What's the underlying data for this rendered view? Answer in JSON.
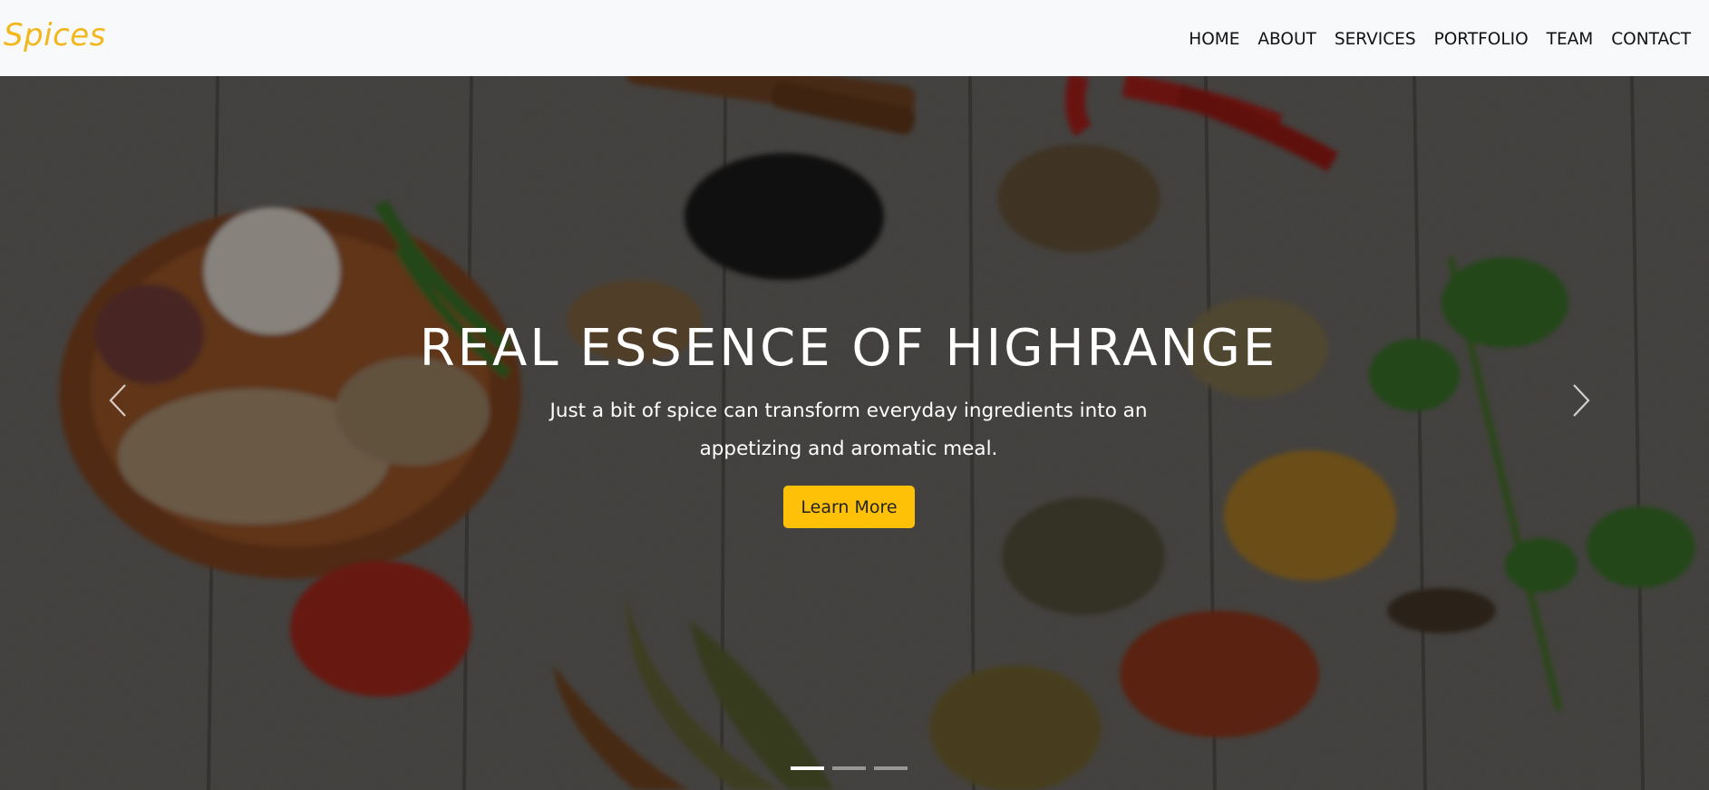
{
  "navbar": {
    "brand": "Spices",
    "links": [
      "HOME",
      "ABOUT",
      "SERVICES",
      "PORTFOLIO",
      "TEAM",
      "CONTACT"
    ]
  },
  "hero": {
    "headline": "REAL ESSENCE OF HIGHRANGE",
    "subtext": "Just a bit of spice can transform everyday ingredients into an appetizing and aromatic meal.",
    "button_label": "Learn More",
    "prev_icon": "chevron-left-icon",
    "next_icon": "chevron-right-icon",
    "slide_count": 3,
    "active_slide": 1
  },
  "colors": {
    "brand": "#f3b71c",
    "button": "#ffc107",
    "navbar_bg": "#f8f9fa"
  }
}
